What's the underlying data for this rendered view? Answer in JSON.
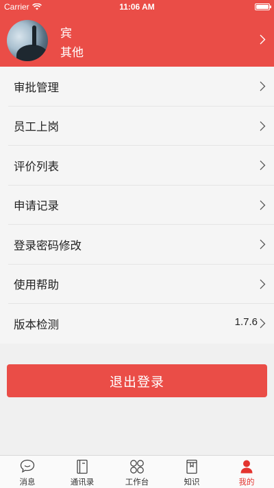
{
  "status_bar": {
    "carrier": "Carrier",
    "time": "11:06 AM"
  },
  "profile": {
    "name": "宾",
    "department": "其他"
  },
  "menu": {
    "items": [
      {
        "label": "审批管理"
      },
      {
        "label": "员工上岗"
      },
      {
        "label": "评价列表"
      },
      {
        "label": "申请记录"
      },
      {
        "label": "登录密码修改"
      },
      {
        "label": "使用帮助"
      },
      {
        "label": "版本检测",
        "value": "1.7.6"
      }
    ]
  },
  "logout_label": "退出登录",
  "tabbar": {
    "tabs": [
      {
        "label": "消息",
        "icon": "message-icon"
      },
      {
        "label": "通讯录",
        "icon": "contacts-icon"
      },
      {
        "label": "工作台",
        "icon": "workbench-icon"
      },
      {
        "label": "知识",
        "icon": "book-icon"
      },
      {
        "label": "我的",
        "icon": "profile-icon",
        "active": true
      }
    ]
  },
  "colors": {
    "brand": "#ea4d47",
    "active_tab": "#e3342f"
  }
}
